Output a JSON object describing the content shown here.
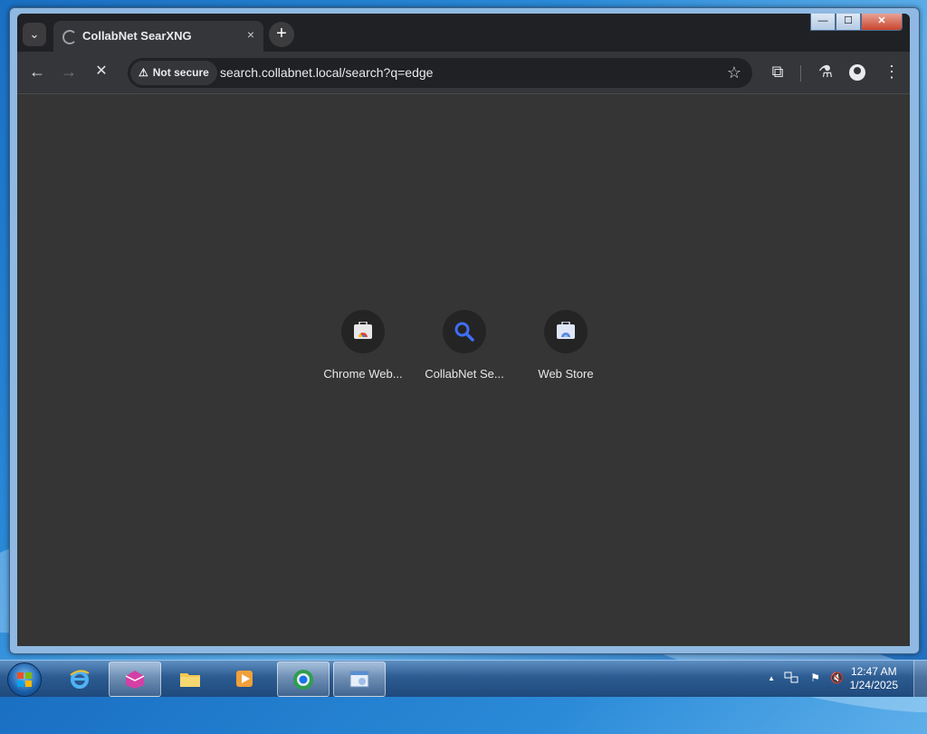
{
  "browser": {
    "tab": {
      "title": "CollabNet SearXNG",
      "close_glyph": "×"
    },
    "new_tab_glyph": "+",
    "tab_search_glyph": "⌄",
    "window_controls": {
      "minimize": "—",
      "maximize": "☐",
      "close": "✕"
    },
    "toolbar": {
      "back_glyph": "←",
      "forward_glyph": "→",
      "stop_glyph": "✕",
      "security_label": "Not secure",
      "security_icon": "warning-icon",
      "url": "search.collabnet.local/search?q=edge",
      "bookmark_glyph": "☆",
      "extensions_glyph": "⧉",
      "labs_glyph": "⚗",
      "menu_glyph": "⋮"
    }
  },
  "shortcuts": [
    {
      "label": "Chrome Web...",
      "icon": "chrome-web-store-icon"
    },
    {
      "label": "CollabNet Se...",
      "icon": "search-magnifier-icon"
    },
    {
      "label": "Web Store",
      "icon": "web-store-icon"
    }
  ],
  "taskbar": {
    "apps": [
      "internet-explorer-icon",
      "app-icon-pink",
      "file-explorer-icon",
      "media-player-icon",
      "chrome-icon",
      "window-app-icon"
    ],
    "tray": {
      "expand_glyph": "▲",
      "flag_glyph": "⚑",
      "volume_glyph": "🔇"
    },
    "clock": {
      "time": "12:47 AM",
      "date": "1/24/2025"
    }
  }
}
